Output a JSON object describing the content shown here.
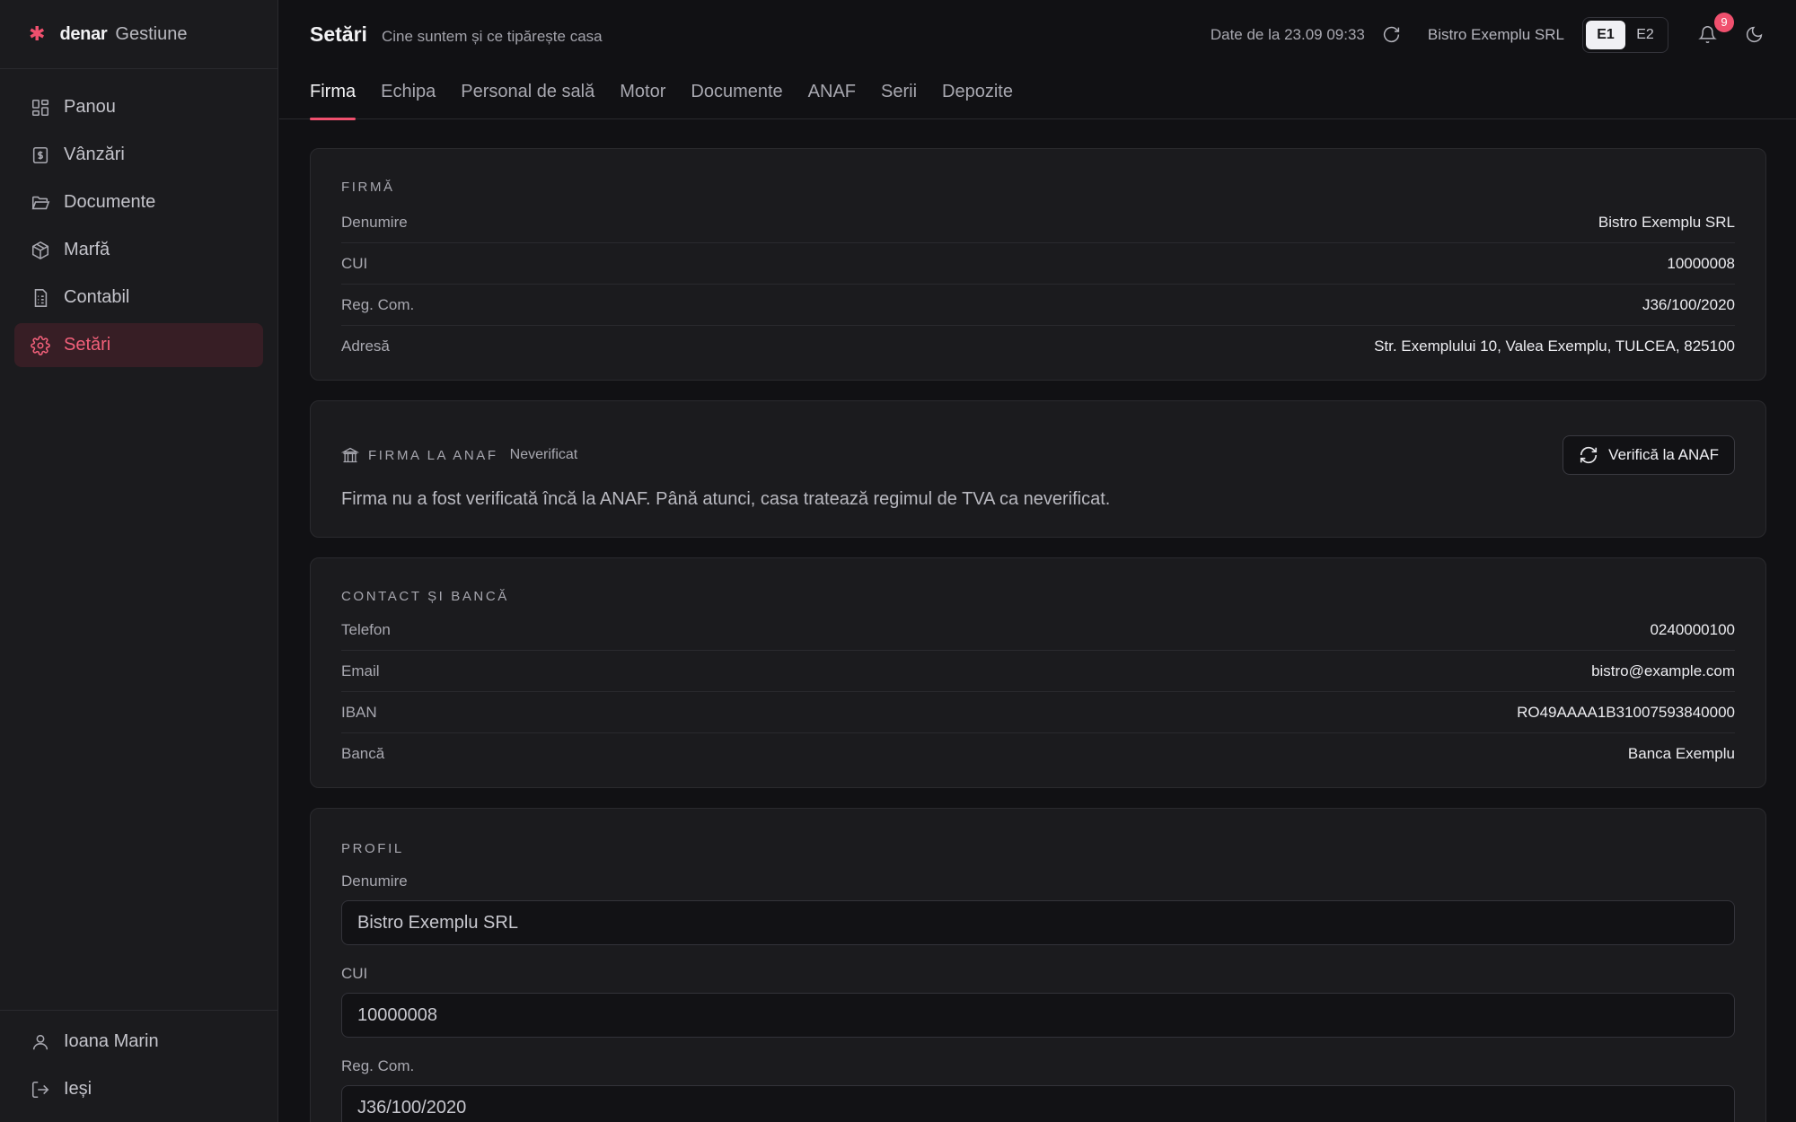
{
  "brand": {
    "name": "denar",
    "module": "Gestiune"
  },
  "sidebar": {
    "items": [
      {
        "label": "Panou",
        "icon": "dashboard-icon"
      },
      {
        "label": "Vânzări",
        "icon": "receipt-dollar-icon"
      },
      {
        "label": "Documente",
        "icon": "folder-open-icon"
      },
      {
        "label": "Marfă",
        "icon": "package-icon"
      },
      {
        "label": "Contabil",
        "icon": "ledger-icon"
      },
      {
        "label": "Setări",
        "icon": "gear-icon",
        "active": true
      }
    ],
    "user": "Ioana Marin",
    "logout": "Ieși"
  },
  "header": {
    "title": "Setări",
    "subtitle": "Cine suntem și ce tipărește casa",
    "sync_status": "Date de la 23.09 09:33",
    "company": "Bistro Exemplu SRL",
    "segments": [
      "E1",
      "E2"
    ],
    "active_segment": "E1",
    "notifications_count": "9"
  },
  "tabs": [
    "Firma",
    "Echipa",
    "Personal de sală",
    "Motor",
    "Documente",
    "ANAF",
    "Serii",
    "Depozite"
  ],
  "active_tab": "Firma",
  "firma": {
    "heading": "Firmă",
    "rows": [
      {
        "key": "Denumire",
        "value": "Bistro Exemplu SRL"
      },
      {
        "key": "CUI",
        "value": "10000008"
      },
      {
        "key": "Reg. Com.",
        "value": "J36/100/2020"
      },
      {
        "key": "Adresă",
        "value": "Str. Exemplului 10, Valea Exemplu, TULCEA, 825100"
      }
    ]
  },
  "anaf": {
    "heading": "Firma la ANAF",
    "status": "Neverificat",
    "button": "Verifică la ANAF",
    "message": "Firma nu a fost verificată încă la ANAF. Până atunci, casa tratează regimul de TVA ca neverificat."
  },
  "contact": {
    "heading": "Contact și bancă",
    "rows": [
      {
        "key": "Telefon",
        "value": "0240000100"
      },
      {
        "key": "Email",
        "value": "bistro@example.com"
      },
      {
        "key": "IBAN",
        "value": "RO49AAAA1B31007593840000"
      },
      {
        "key": "Bancă",
        "value": "Banca Exemplu"
      }
    ]
  },
  "profil": {
    "heading": "Profil",
    "fields": [
      {
        "label": "Denumire",
        "value": "Bistro Exemplu SRL"
      },
      {
        "label": "CUI",
        "value": "10000008"
      },
      {
        "label": "Reg. Com.",
        "value": "J36/100/2020"
      }
    ]
  },
  "colors": {
    "accent": "#f0506e",
    "background": "#111114",
    "panel": "#1b1b1e"
  }
}
